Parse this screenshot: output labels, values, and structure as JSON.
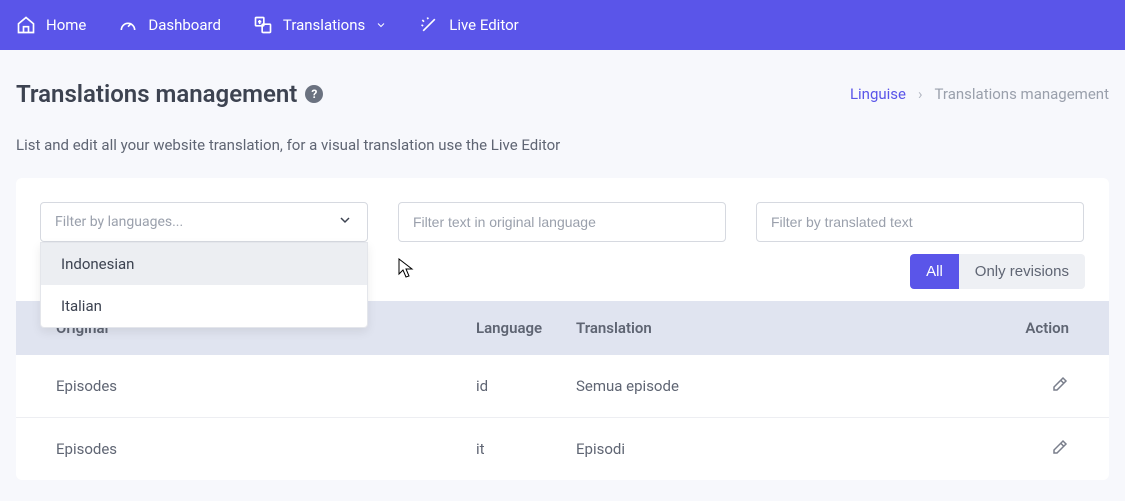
{
  "nav": {
    "home": "Home",
    "dashboard": "Dashboard",
    "translations": "Translations",
    "live_editor": "Live Editor"
  },
  "page": {
    "title": "Translations management",
    "subtitle": "List and edit all your website translation, for a visual translation use the Live Editor"
  },
  "breadcrumbs": {
    "root": "Linguise",
    "current": "Translations management"
  },
  "filters": {
    "language_placeholder": "Filter by languages...",
    "original_placeholder": "Filter text in original language",
    "translated_placeholder": "Filter by translated text",
    "language_options": [
      "Indonesian",
      "Italian"
    ]
  },
  "toggle": {
    "all": "All",
    "revisions": "Only revisions"
  },
  "table": {
    "headers": {
      "original": "Original",
      "language": "Language",
      "translation": "Translation",
      "action": "Action"
    },
    "rows": [
      {
        "original": "Episodes",
        "language": "id",
        "translation": "Semua episode"
      },
      {
        "original": "Episodes",
        "language": "it",
        "translation": "Episodi"
      }
    ]
  }
}
